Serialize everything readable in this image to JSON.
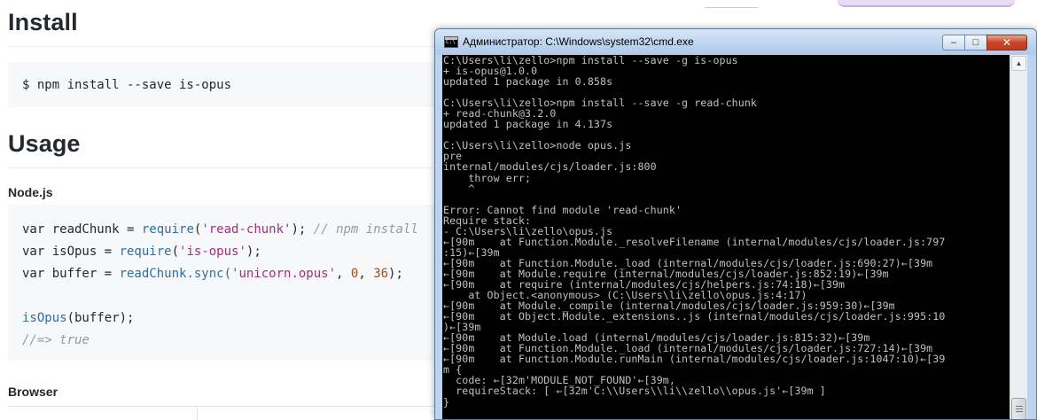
{
  "readme": {
    "install_heading": "Install",
    "install_command": "$ npm install --save is-opus",
    "usage_heading": "Usage",
    "node_heading": "Node.js",
    "browser_heading": "Browser",
    "code": {
      "line1": {
        "kw": "var ",
        "name": "readChunk = ",
        "fn": "require",
        "p1": "(",
        "str": "'read-chunk'",
        "p2": "); ",
        "comment": "// npm install"
      },
      "line2": {
        "kw": "var ",
        "name": "isOpus = ",
        "fn": "require",
        "p1": "(",
        "str": "'is-opus'",
        "p2": ");"
      },
      "line3": {
        "kw": "var ",
        "name": "buffer = ",
        "fn": "readChunk",
        "mid": ".sync(",
        "str": "'unicorn.opus'",
        "sep1": ", ",
        "num1": "0",
        "sep2": ", ",
        "num2": "36",
        "p2": ");"
      },
      "line5": {
        "fn": "isOpus",
        "rest": "(buffer);"
      },
      "line6": {
        "comment": "//=> true"
      }
    }
  },
  "cmd": {
    "title": "Администратор: C:\\Windows\\system32\\cmd.exe",
    "min_glyph": "‒",
    "max_glyph": "□",
    "close_glyph": "✕",
    "scroll_up_glyph": "▲",
    "output": "C:\\Users\\li\\zello>npm install --save -g is-opus\n+ is-opus@1.0.0\nupdated 1 package in 0.858s\n\nC:\\Users\\li\\zello>npm install --save -g read-chunk\n+ read-chunk@3.2.0\nupdated 1 package in 4.137s\n\nC:\\Users\\li\\zello>node opus.js\npre\ninternal/modules/cjs/loader.js:800\n    throw err;\n    ^\n\nError: Cannot find module 'read-chunk'\nRequire stack:\n- C:\\Users\\li\\zello\\opus.js\n←[90m    at Function.Module._resolveFilename (internal/modules/cjs/loader.js:797\n:15)←[39m\n←[90m    at Function.Module._load (internal/modules/cjs/loader.js:690:27)←[39m\n←[90m    at Module.require (internal/modules/cjs/loader.js:852:19)←[39m\n←[90m    at require (internal/modules/cjs/helpers.js:74:18)←[39m\n    at Object.<anonymous> (C:\\Users\\li\\zello\\opus.js:4:17)\n←[90m    at Module._compile (internal/modules/cjs/loader.js:959:30)←[39m\n←[90m    at Object.Module._extensions..js (internal/modules/cjs/loader.js:995:10\n)←[39m\n←[90m    at Module.load (internal/modules/cjs/loader.js:815:32)←[39m\n←[90m    at Function.Module._load (internal/modules/cjs/loader.js:727:14)←[39m\n←[90m    at Function.Module.runMain (internal/modules/cjs/loader.js:1047:10)←[39\nm {\n  code: ←[32m'MODULE_NOT_FOUND'←[39m,\n  requireStack: [ ←[32m'C:\\\\Users\\\\li\\\\zello\\\\opus.js'←[39m ]\n}\n\nC:\\Users\\li\\zello>"
  }
}
